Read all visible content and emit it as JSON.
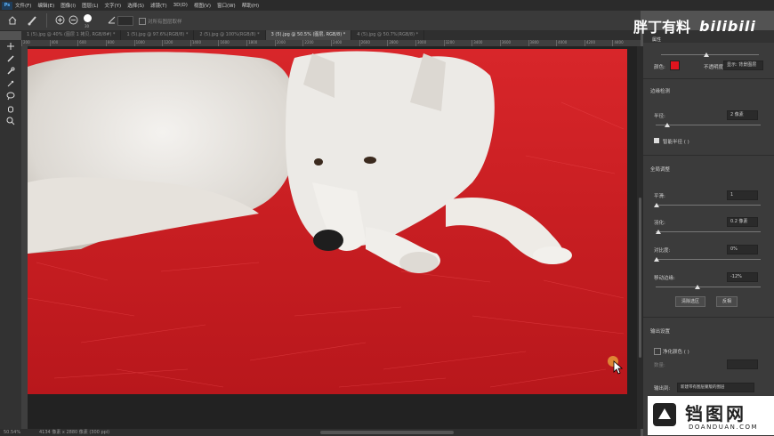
{
  "menu": {
    "logo": "Ps",
    "items": [
      "文件(F)",
      "编辑(E)",
      "图像(I)",
      "图层(L)",
      "文字(Y)",
      "选择(S)",
      "滤镜(T)",
      "3D(D)",
      "视图(V)",
      "窗口(W)",
      "帮助(H)"
    ]
  },
  "options": {
    "brush_size": "30",
    "sample_label": "对所有图层取样"
  },
  "tabs": [
    {
      "label": "1 (5).jpg @ 40% (图层 1 拷贝, RGB/8#) *",
      "active": false
    },
    {
      "label": "1 (5).jpg @ 97.6%(RGB/8) *",
      "active": false
    },
    {
      "label": "2 (5).jpg @ 100%(RGB/8) *",
      "active": false
    },
    {
      "label": "3 (5).jpg @ 50.5% (图层, RGB/8) *",
      "active": true
    },
    {
      "label": "4 (5).jpg @ 50.7%(RGB/8) *",
      "active": false
    }
  ],
  "ruler": [
    "200",
    "400",
    "600",
    "800",
    "1000",
    "1200",
    "1400",
    "1600",
    "1800",
    "2000",
    "2200",
    "2400",
    "2600",
    "2800",
    "3000",
    "3200",
    "3400",
    "3600",
    "3800",
    "4000",
    "4200",
    "4400"
  ],
  "tools": [
    "move-icon",
    "brush-icon",
    "quick-select-icon",
    "refine-brush-icon",
    "lasso-icon",
    "hand-icon",
    "zoom-icon"
  ],
  "status": {
    "zoom": "50.54%",
    "doc": "4134 像素 x 2880 像素 (300 ppi)"
  },
  "panel": {
    "header": "属性",
    "color_label": "颜色:",
    "color_value": "#e0141e",
    "opacity_label": "不透明度",
    "opacity_select": "显示: 背景图层",
    "edge_section": "边缘检测",
    "radius_label": "半径:",
    "radius_value": "2 像素",
    "smart_radius_label": "智能半径 ( )",
    "global_section": "全局调整",
    "smooth_label": "平滑:",
    "smooth_value": "1",
    "feather_label": "羽化:",
    "feather_value": "0.2 像素",
    "contrast_label": "对比度:",
    "contrast_value": "0%",
    "shift_label": "移动边缘:",
    "shift_value": "-12%",
    "clear_btn": "清除选区",
    "invert_btn": "反相",
    "output_section": "输出设置",
    "decontam_label": "净化颜色 ( )",
    "amount_label": "数量:",
    "output_to_label": "输出到:",
    "output_to_value": "新建带有图层蒙版的图层"
  },
  "watermark": {
    "top": "胖丁有料",
    "top_brand": "bilibili",
    "bottom": "铛图网",
    "bottom_url": "DOANDUAN.COM"
  }
}
